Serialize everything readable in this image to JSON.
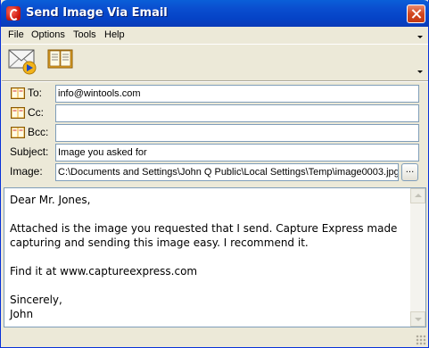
{
  "window": {
    "title": "Send Image Via Email"
  },
  "menu": {
    "items": [
      "File",
      "Options",
      "Tools",
      "Help"
    ]
  },
  "toolbar": {
    "buttons": [
      {
        "icon": "send-envelope-icon"
      },
      {
        "icon": "address-book-icon"
      }
    ]
  },
  "fields": {
    "to": {
      "label": "To:",
      "value": "info@wintools.com"
    },
    "cc": {
      "label": "Cc:",
      "value": ""
    },
    "bcc": {
      "label": "Bcc:",
      "value": ""
    },
    "subject": {
      "label": "Subject:",
      "value": "Image you asked for"
    },
    "image": {
      "label": "Image:",
      "value": "C:\\Documents and Settings\\John Q Public\\Local Settings\\Temp\\image0003.jpg",
      "browse_label": "..."
    }
  },
  "body": {
    "text": "Dear Mr. Jones,\n\nAttached is the image you requested that I send. Capture Express made capturing and sending this image easy. I recommend it.\n\nFind it at www.captureexpress.com\n\nSincerely,\nJohn"
  },
  "colors": {
    "titlebar": "#0a4fd0",
    "close_button": "#d2471f",
    "chrome": "#ece9d8",
    "input_border": "#7f9db9"
  }
}
